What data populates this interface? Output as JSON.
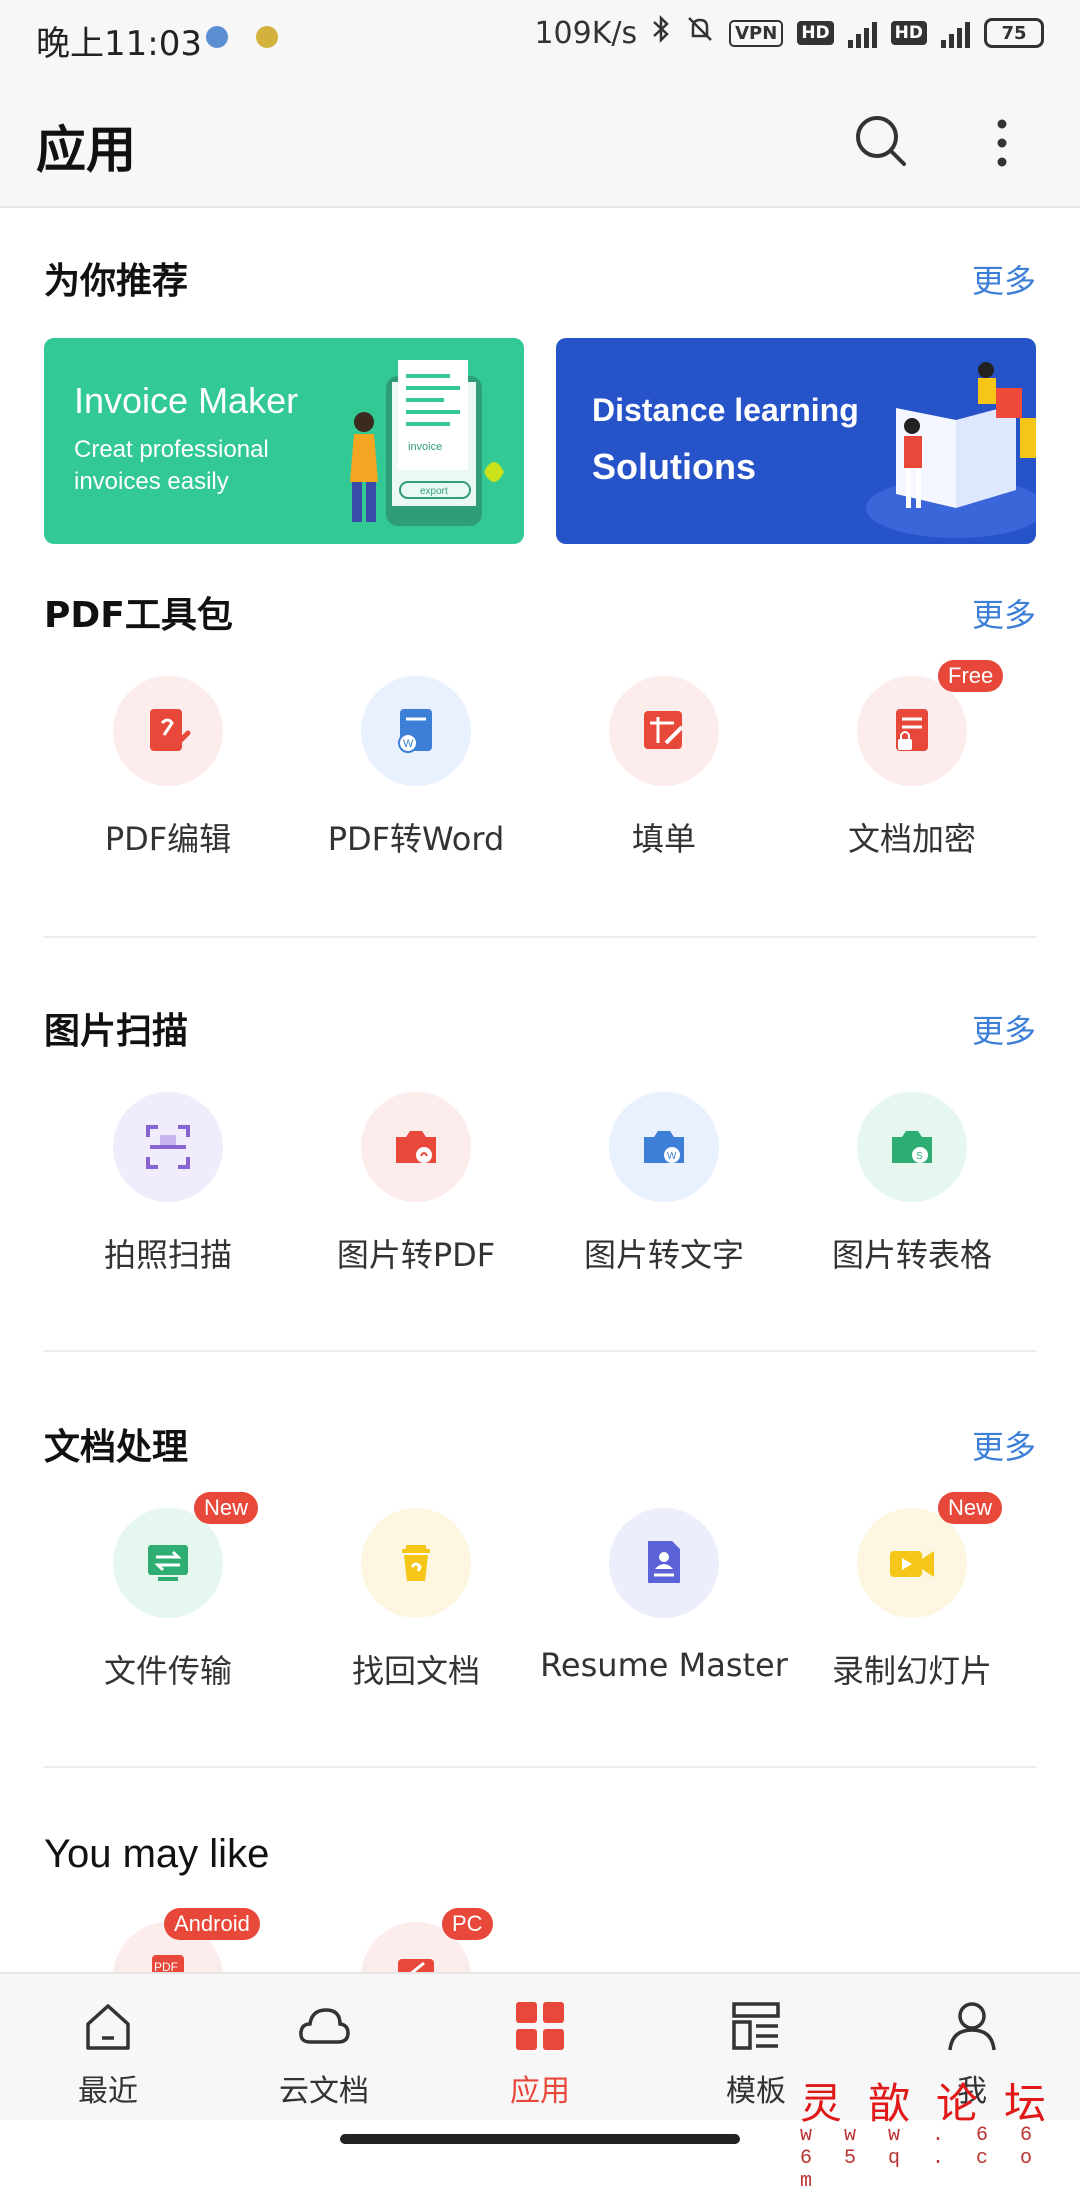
{
  "status_bar": {
    "time": "晚上11:03",
    "speed": "109K/s",
    "vpn": "VPN",
    "hd": "HD",
    "network": "4G",
    "battery": "75"
  },
  "header": {
    "title": "应用"
  },
  "recommend": {
    "title": "为你推荐",
    "more": "更多",
    "banner1": {
      "title": "Invoice Maker",
      "line1": "Creat professional",
      "line2": "invoices easily",
      "doc_label": "invoice",
      "btn_label": "export"
    },
    "banner2": {
      "line1": "Distance learning",
      "line2": "Solutions"
    }
  },
  "pdf_tools": {
    "title": "PDF工具包",
    "more": "更多",
    "items": [
      {
        "label": "PDF编辑"
      },
      {
        "label": "PDF转Word"
      },
      {
        "label": "填单"
      },
      {
        "label": "文档加密",
        "badge": "Free"
      }
    ]
  },
  "image_scan": {
    "title": "图片扫描",
    "more": "更多",
    "items": [
      {
        "label": "拍照扫描"
      },
      {
        "label": "图片转PDF"
      },
      {
        "label": "图片转文字"
      },
      {
        "label": "图片转表格"
      }
    ]
  },
  "doc_processing": {
    "title": "文档处理",
    "more": "更多",
    "items": [
      {
        "label": "文件传输",
        "badge": "New"
      },
      {
        "label": "找回文档"
      },
      {
        "label": "Resume Master"
      },
      {
        "label": "录制幻灯片",
        "badge": "New"
      }
    ]
  },
  "you_may_like": {
    "title": "You may like",
    "items": [
      {
        "badge": "Android",
        "icon_text": "PDF"
      },
      {
        "badge": "PC"
      }
    ]
  },
  "bottom_nav": {
    "items": [
      {
        "label": "最近"
      },
      {
        "label": "云文档"
      },
      {
        "label": "应用"
      },
      {
        "label": "模板"
      },
      {
        "label": "我"
      }
    ]
  },
  "watermark": {
    "text": "灵歆论坛",
    "url": "w w w . 6 6 6 5 q . c o m"
  },
  "colors": {
    "accent": "#e8483a",
    "link": "#3d7fd6",
    "banner_green": "#33c995",
    "banner_blue": "#2653c8"
  }
}
